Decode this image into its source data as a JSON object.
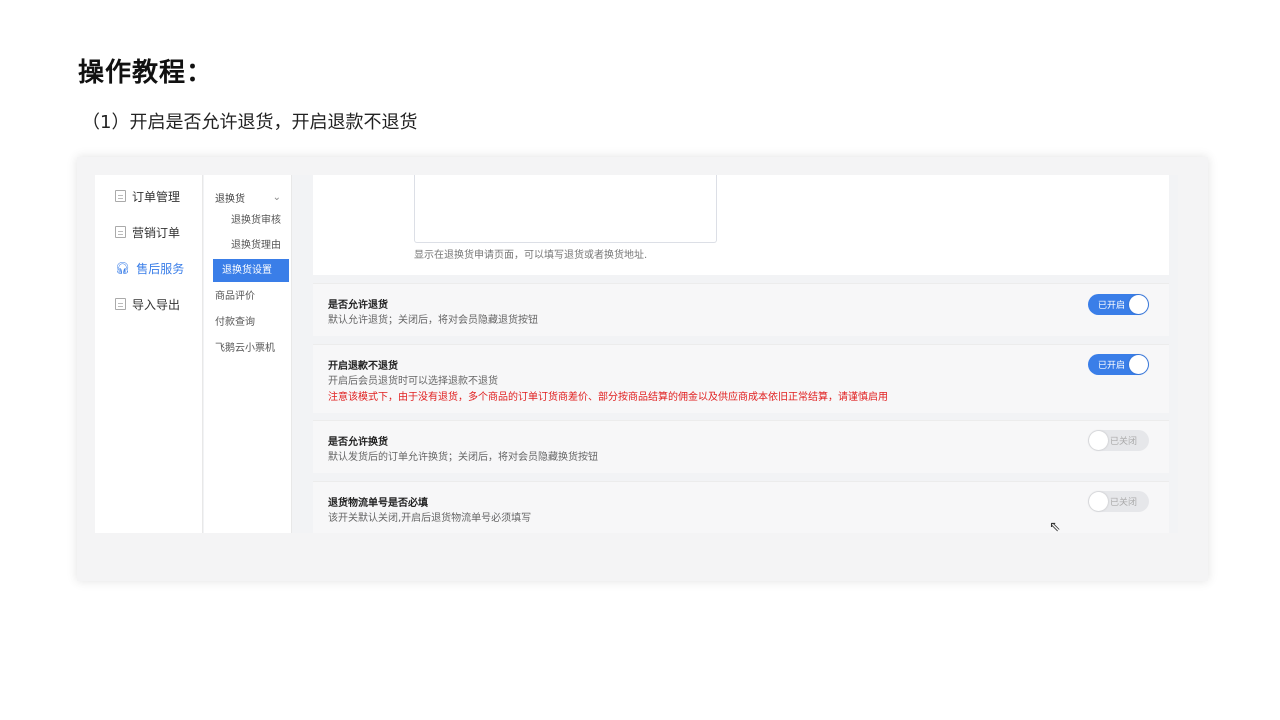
{
  "heading": "操作教程：",
  "step": "（1）开启是否允许退货，开启退款不退货",
  "sidebar": {
    "items": [
      {
        "label": "订单管理",
        "icon": "document-icon"
      },
      {
        "label": "营销订单",
        "icon": "document-icon"
      },
      {
        "label": "售后服务",
        "icon": "headset-icon",
        "active": true
      },
      {
        "label": "导入导出",
        "icon": "import-export-icon"
      }
    ]
  },
  "subnav": {
    "group": "退换货",
    "sub_items": [
      "退换货审核",
      "退换货理由",
      "退换货设置"
    ],
    "active": "退换货设置",
    "items": [
      "商品评价",
      "付款查询",
      "飞鹅云小票机"
    ]
  },
  "address": {
    "hint": "显示在退换货申请页面，可以填写退货或者换货地址."
  },
  "settings": [
    {
      "title": "是否允许退货",
      "desc": "默认允许退货；关闭后，将对会员隐藏退货按钮",
      "warn": "",
      "state": "已开启",
      "on": true
    },
    {
      "title": "开启退款不退货",
      "desc": "开启后会员退货时可以选择退款不退货",
      "warn": "注意该模式下，由于没有退货，多个商品的订单订货商差价、部分按商品结算的佣金以及供应商成本依旧正常结算，请谨慎启用",
      "state": "已开启",
      "on": true
    },
    {
      "title": "是否允许换货",
      "desc": "默认发货后的订单允许换货；关闭后，将对会员隐藏换货按钮",
      "warn": "",
      "state": "已关闭",
      "on": false
    },
    {
      "title": "退货物流单号是否必填",
      "desc": "该开关默认关闭,开启后退货物流单号必须填写",
      "warn": "",
      "state": "已关闭",
      "on": false
    }
  ],
  "colors": {
    "accent": "#3a7ee8",
    "warning": "#e02020"
  }
}
